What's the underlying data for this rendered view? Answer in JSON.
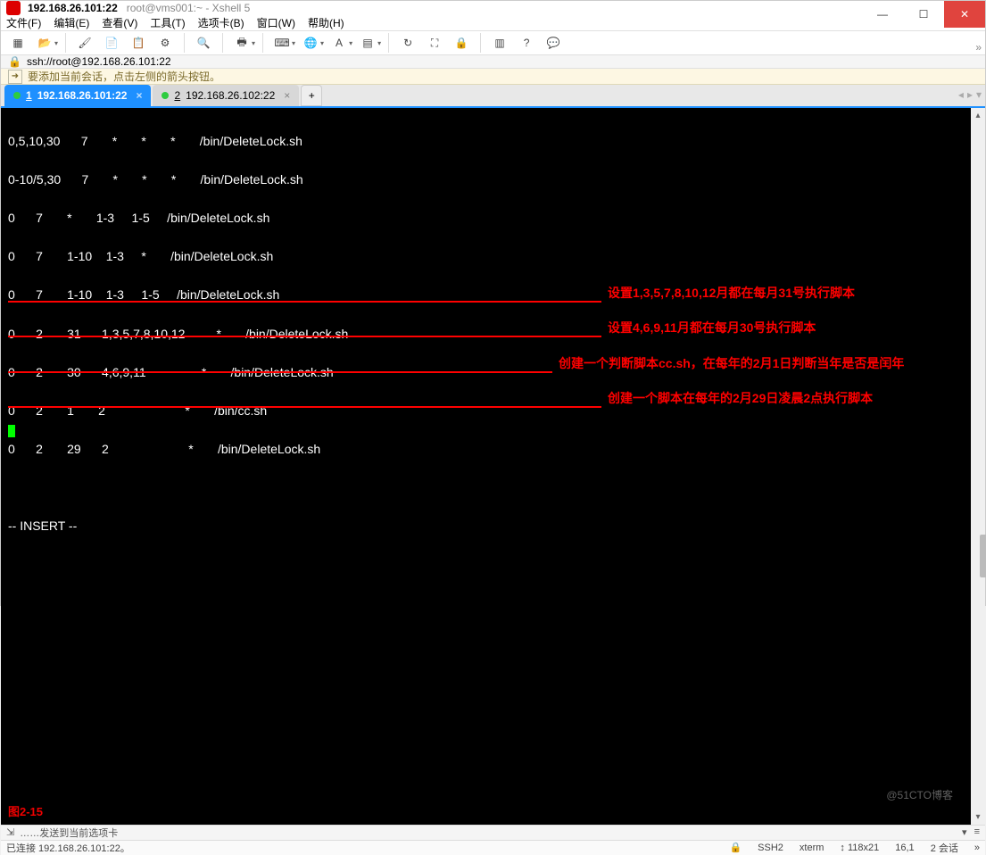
{
  "title": {
    "host": "192.168.26.101:22",
    "rest": "root@vms001:~ - Xshell 5"
  },
  "menu": {
    "file": "文件(F)",
    "edit": "编辑(E)",
    "view": "查看(V)",
    "tools": "工具(T)",
    "tab": "选项卡(B)",
    "window": "窗口(W)",
    "help": "帮助(H)"
  },
  "address": "ssh://root@192.168.26.101:22",
  "infobar_text": "要添加当前会话，点击左侧的箭头按钮。",
  "tabs": {
    "t1_num": "1",
    "t1_host": "192.168.26.101:22",
    "t2_num": "2",
    "t2_host": "192.168.26.102:22",
    "add": "+"
  },
  "term": {
    "l1": "0,5,10,30      7       *       *       *       /bin/DeleteLock.sh",
    "l2": "",
    "l3": "0-10/5,30      7       *       *       *       /bin/DeleteLock.sh",
    "l4": "",
    "l5": "0      7       *       1-3     1-5     /bin/DeleteLock.sh",
    "l6": "",
    "l7": "0      7       1-10    1-3     *       /bin/DeleteLock.sh",
    "l8": "",
    "l9": "0      7       1-10    1-3     1-5     /bin/DeleteLock.sh",
    "l10": "",
    "l11": "0      2       31      1,3,5,7,8,10,12         *       /bin/DeleteLock.sh",
    "l12": "",
    "l13": "0      2       30      4,6,9,11                *       /bin/DeleteLock.sh",
    "l14": "",
    "l15": "0      2       1       2                       *       /bin/cc.sh",
    "l16": "",
    "l17": "0      2       29      2                       *       /bin/DeleteLock.sh",
    "l18": "",
    "l19": "",
    "l20": "",
    "l21": "-- INSERT --"
  },
  "annotations": {
    "a1": "设置1,3,5,7,8,10,12月都在每月31号执行脚本",
    "a2": "设置4,6,9,11月都在每月30号执行脚本",
    "a3": "创建一个判断脚本cc.sh，在每年的2月1日判断当年是否是闰年",
    "a4": "创建一个脚本在每年的2月29日凌晨2点执行脚本",
    "fig": "图2-15"
  },
  "bottombar": "……发送到当前选项卡",
  "status": {
    "conn": "已连接 192.168.26.101:22。",
    "ssh": "SSH2",
    "term": "xterm",
    "size": "118x21",
    "pos": "16,1",
    "sessions": "2 会话"
  },
  "watermark": "@51CTO博客",
  "icons": {
    "minimize": "—",
    "maximize": "☐",
    "close": "✕",
    "new": "▦",
    "open": "📂",
    "paint": "🖌",
    "copy": "📄",
    "paste": "📋",
    "script": "⚙",
    "search": "🔍",
    "print": "🖶",
    "keyboard": "⌨",
    "globe": "🌐",
    "font": "A",
    "fill": "▤",
    "loop": "↻",
    "fullscreen": "⛶",
    "lock": "🔒",
    "split": "▥",
    "help": "?",
    "comment": "💬",
    "arrow": "➜",
    "chev": "▾",
    "chev_r": "»",
    "tri_l": "◂",
    "tri_r": "▸",
    "tri_u": "▴",
    "tri_d": "▾",
    "sizesep": "↕",
    "lines": "≡",
    "plusarrow": "⇲"
  }
}
